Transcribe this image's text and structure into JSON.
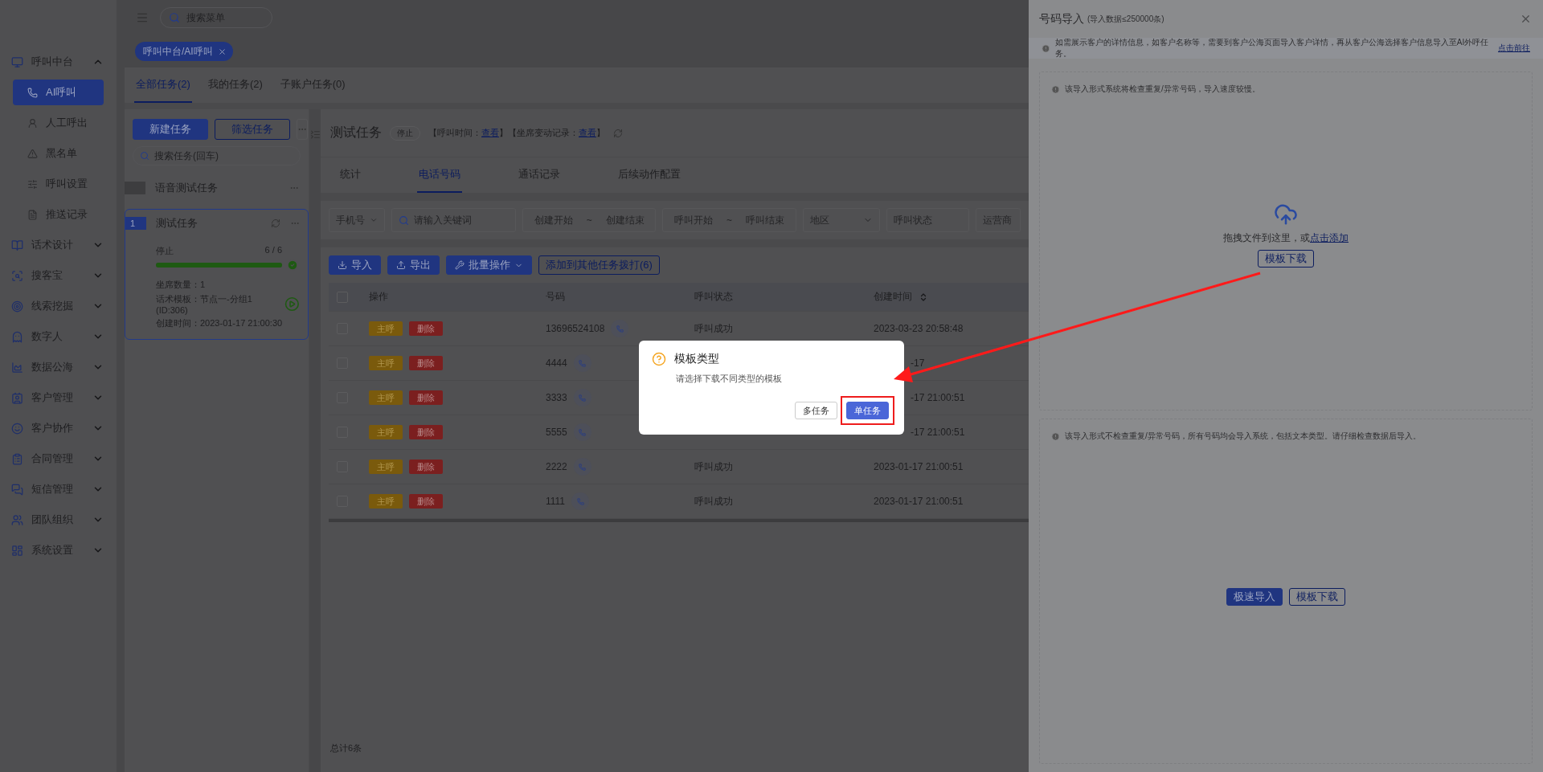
{
  "header": {
    "search_placeholder": "搜索菜单"
  },
  "breadcrumb_tag": "呼叫中台/AI呼叫",
  "sidebar": {
    "items": [
      {
        "label": "呼叫中台",
        "expanded": true,
        "children": [
          {
            "label": "AI呼叫",
            "selected": true
          },
          {
            "label": "人工呼出",
            "selected": false
          },
          {
            "label": "黑名单",
            "selected": false
          },
          {
            "label": "呼叫设置",
            "selected": false
          },
          {
            "label": "推送记录",
            "selected": false
          }
        ]
      },
      {
        "label": "话术设计",
        "expanded": false
      },
      {
        "label": "搜客宝",
        "expanded": false
      },
      {
        "label": "线索挖掘",
        "expanded": false
      },
      {
        "label": "数字人",
        "expanded": false
      },
      {
        "label": "数据公海",
        "expanded": false
      },
      {
        "label": "客户管理",
        "expanded": false
      },
      {
        "label": "客户协作",
        "expanded": false
      },
      {
        "label": "合同管理",
        "expanded": false
      },
      {
        "label": "短信管理",
        "expanded": false
      },
      {
        "label": "团队组织",
        "expanded": false
      },
      {
        "label": "系统设置",
        "expanded": false
      }
    ]
  },
  "task_tabs": [
    {
      "label": "全部任务(2)",
      "selected": true
    },
    {
      "label": "我的任务(2)",
      "selected": false
    },
    {
      "label": "子账户任务(0)",
      "selected": false
    }
  ],
  "task_panel": {
    "buttons": [
      {
        "label": "新建任务",
        "kind": "primary"
      },
      {
        "label": "筛选任务",
        "kind": "outline"
      }
    ],
    "search_placeholder": "搜索任务(回车)",
    "tasks": [
      {
        "name": "语音测试任务",
        "selected": false
      },
      {
        "name": "测试任务",
        "selected": true,
        "badge": "1",
        "status": "停止",
        "progress": "6 / 6",
        "level": 1,
        "details": [
          {
            "label": "坐席数量：",
            "value": "1"
          },
          {
            "label": "话术模板：",
            "value": "节点一-分组1 (ID:306)"
          },
          {
            "label": "创建时间：",
            "value": "2023-01-17 21:00:30"
          }
        ]
      }
    ]
  },
  "detail": {
    "title": "测试任务",
    "status": "停止",
    "meta": [
      {
        "label": "【呼叫时间：",
        "link": "查看",
        "suffix": "】"
      },
      {
        "label": "【坐席变动记录：",
        "link": "查看",
        "suffix": "】"
      }
    ],
    "tabs": [
      {
        "label": "统计",
        "selected": false
      },
      {
        "label": "电话号码",
        "selected": true
      },
      {
        "label": "通话记录",
        "selected": false
      },
      {
        "label": "后续动作配置",
        "selected": false
      }
    ],
    "filters": [
      {
        "kind": "select",
        "value": "手机号"
      },
      {
        "kind": "search",
        "placeholder": "请输入关键词"
      },
      {
        "kind": "range",
        "start": "创建开始",
        "separator": "~",
        "end": "创建结束"
      },
      {
        "kind": "range",
        "start": "呼叫开始",
        "separator": "~",
        "end": "呼叫结束"
      },
      {
        "kind": "dropdown",
        "placeholder": "地区"
      },
      {
        "kind": "input",
        "placeholder": "呼叫状态"
      },
      {
        "kind": "input",
        "placeholder": "运营商"
      }
    ],
    "toolbar": [
      {
        "label": "导入",
        "kind": "primary",
        "dropdown": false
      },
      {
        "label": "导出",
        "kind": "primary",
        "dropdown": false
      },
      {
        "label": "批量操作",
        "kind": "primary",
        "dropdown": true
      },
      {
        "label": "添加到其他任务拨打(6)",
        "kind": "outline",
        "dropdown": false
      }
    ],
    "table": {
      "all_checked": false,
      "columns": [
        {
          "label": "操作",
          "sortable": false
        },
        {
          "label": "号码",
          "sortable": false
        },
        {
          "label": "呼叫状态",
          "sortable": false
        },
        {
          "label": "创建时间",
          "sortable": true
        }
      ],
      "rows": [
        {
          "checked": false,
          "actions": [
            "主呼",
            "删除"
          ],
          "number": "13696524108",
          "status": "呼叫成功",
          "time": "2023-03-23 20:58:48",
          "time_cut": false
        },
        {
          "checked": false,
          "actions": [
            "主呼",
            "删除"
          ],
          "number": "4444",
          "time": "-17",
          "time_cut": true
        },
        {
          "checked": false,
          "actions": [
            "主呼",
            "删除"
          ],
          "number": "3333",
          "time": "-17 21:00:51",
          "time_cut": true
        },
        {
          "checked": false,
          "actions": [
            "主呼",
            "删除"
          ],
          "number": "5555",
          "time": "-17 21:00:51",
          "time_cut": true
        },
        {
          "checked": false,
          "actions": [
            "主呼",
            "删除"
          ],
          "number": "2222",
          "status": "呼叫成功",
          "time": "2023-01-17 21:00:51",
          "time_cut": false
        },
        {
          "checked": false,
          "actions": [
            "主呼",
            "删除"
          ],
          "number": "1111",
          "status": "呼叫成功",
          "time": "2023-01-17 21:00:51",
          "time_cut": false
        }
      ]
    },
    "footer": "总计6条"
  },
  "drawer": {
    "title": "号码导入",
    "subtitle": "(导入数据≤250000条)",
    "notice": "如需展示客户的详情信息，如客户名称等，需要到客户公海页面导入客户详情，再从客户公海选择客户信息导入至AI外呼任务。",
    "notice_link": "点击前往",
    "sections": [
      {
        "kind": "upload",
        "note": "该导入形式系统将检查重复/异常号码，导入速度较慢。",
        "drop_text": "拖拽文件到这里，或",
        "drop_link": "点击添加",
        "buttons": [
          {
            "label": "模板下载",
            "kind": "outline"
          }
        ]
      },
      {
        "kind": "fast",
        "note": "该导入形式不检查重复/异常号码，所有号码均会导入系统，包括文本类型。请仔细检查数据后导入。",
        "buttons": [
          {
            "label": "极速导入",
            "kind": "primary"
          },
          {
            "label": "模板下载",
            "kind": "outline"
          }
        ]
      }
    ]
  },
  "dialog": {
    "title": "模板类型",
    "message": "请选择下载不同类型的模板",
    "buttons": [
      {
        "label": "多任务",
        "selected": false
      },
      {
        "label": "单任务",
        "selected": true
      }
    ]
  }
}
